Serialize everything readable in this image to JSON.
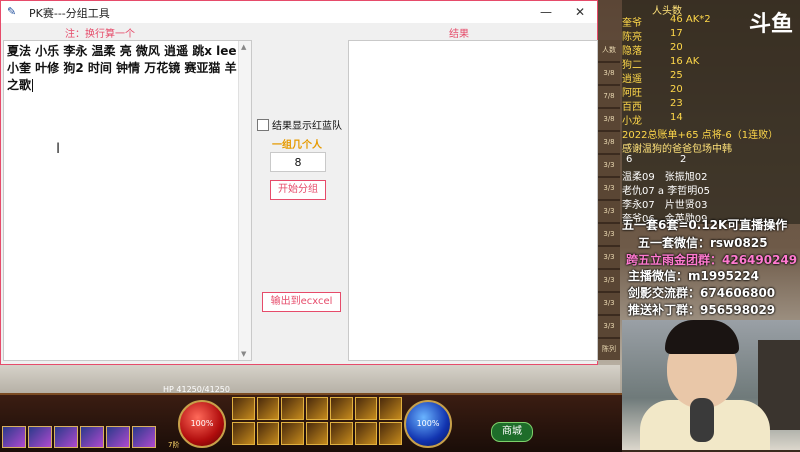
{
  "window": {
    "title": "PK赛---分组工具",
    "minimize_glyph": "—",
    "close_glyph": "✕"
  },
  "left_panel": {
    "note_label": "注：换行算一个",
    "names_text": "夏法 小乐 李永 温柔 亮 微风 逍遥 跳x lee 小奎 叶修 狗2 时间 钟情 万花镜 赛亚猫 羊之歌"
  },
  "right_panel": {
    "result_label": "结果"
  },
  "controls": {
    "show_red_blue_label": "结果显示红蓝队",
    "show_red_blue_checked": false,
    "per_group_label": "一组几个人",
    "per_group_value": "8",
    "start_button": "开始分组",
    "export_button": "输出到ecxcel"
  },
  "stream_overlay": {
    "logo": "斗鱼",
    "side_tabs": [
      "人数",
      "3/8",
      "7/8",
      "3/8",
      "3/8",
      "3/3",
      "3/3",
      "3/3",
      "3/3",
      "3/3",
      "3/3",
      "3/3",
      "3/3",
      "陈列"
    ],
    "roster_header": "人头数",
    "roster": [
      {
        "name": "奎爷",
        "value": "46 AK*2"
      },
      {
        "name": "陈亮",
        "value": "17"
      },
      {
        "name": "隐落",
        "value": "20"
      },
      {
        "name": "狗二",
        "value": "16 AK"
      },
      {
        "name": "逍遥",
        "value": "25"
      },
      {
        "name": "阿旺",
        "value": "20"
      },
      {
        "name": "百西",
        "value": "23"
      },
      {
        "name": "小龙",
        "value": "14"
      }
    ],
    "summary_line": "2022总账单+65 点将-6（1连败）",
    "thanks_line": "感谢温狗的爸爸包场中韩",
    "score_line_a": "6",
    "score_line_b": "2",
    "pairs": [
      "温柔09　张振旭02",
      "老仇07 a 李哲明05",
      "李永07　片世贤03",
      "奎爷06　金英勋09"
    ],
    "promos": [
      {
        "text": "五一套6套=0.12K可直播操作",
        "color": "blue"
      },
      {
        "text": "五一套微信：rsw0825",
        "color": "blue"
      },
      {
        "text": "跨五立雨金团群：426490249",
        "color": "pink"
      },
      {
        "text": "主播微信：m1995224",
        "color": "blue"
      },
      {
        "text": "剑影交流群：674606800",
        "color": "blue"
      },
      {
        "text": "推送补丁群：956598029",
        "color": "blue"
      }
    ]
  },
  "game_hud": {
    "hp_text": "HP 41250/41250",
    "hp_percent": "100%",
    "mp_percent": "100%",
    "level_text": "7阶",
    "mall_button": "商城"
  }
}
